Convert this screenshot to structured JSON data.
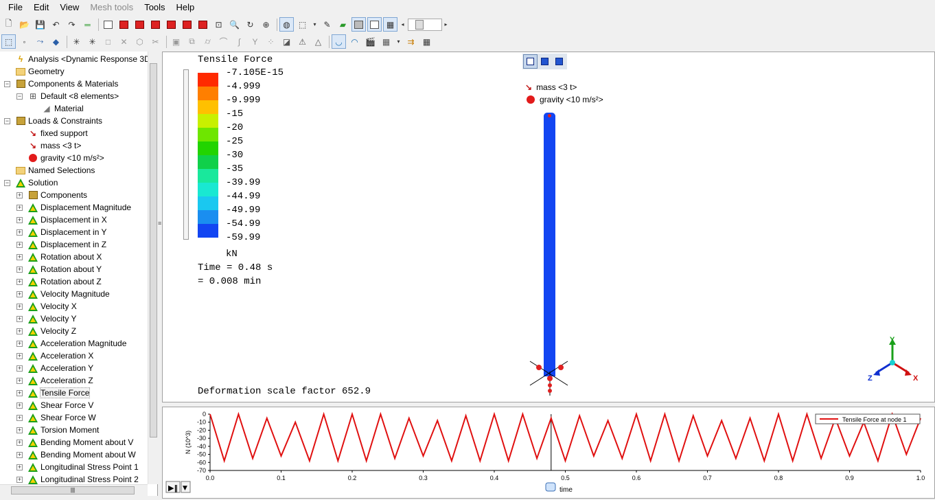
{
  "menu": [
    "File",
    "Edit",
    "View",
    "Mesh tools",
    "Tools",
    "Help"
  ],
  "menu_disabled": [
    false,
    false,
    false,
    true,
    false,
    false
  ],
  "tree": [
    {
      "label": "Analysis <Dynamic Response 3D",
      "icon": "analysis-icon",
      "level": 1,
      "exp": null
    },
    {
      "label": "Geometry",
      "icon": "folder-icon",
      "level": 1,
      "exp": null
    },
    {
      "label": "Components & Materials",
      "icon": "components-icon",
      "level": 1,
      "exp": "-"
    },
    {
      "label": "Default <8 elements>",
      "icon": "element-icon",
      "level": 2,
      "exp": "-"
    },
    {
      "label": "Material",
      "icon": "material-icon",
      "level": 3,
      "exp": null
    },
    {
      "label": "Loads & Constraints",
      "icon": "loads-icon",
      "level": 1,
      "exp": "-"
    },
    {
      "label": "fixed support",
      "icon": "support-arrow-icon",
      "level": 2,
      "exp": null
    },
    {
      "label": "mass <3 t>",
      "icon": "mass-arrow-icon",
      "level": 2,
      "exp": null
    },
    {
      "label": "gravity <10 m/s²>",
      "icon": "gravity-apple-icon",
      "level": 2,
      "exp": null
    },
    {
      "label": "Named Selections",
      "icon": "named-selections-icon",
      "level": 1,
      "exp": null
    },
    {
      "label": "Solution",
      "icon": "solution-triangle-icon",
      "level": 1,
      "exp": "-"
    },
    {
      "label": "Components",
      "icon": "components-icon",
      "level": 2,
      "exp": "+"
    },
    {
      "label": "Displacement Magnitude",
      "icon": "result-triangle-icon",
      "level": 2,
      "exp": "+"
    },
    {
      "label": "Displacement in X",
      "icon": "result-triangle-icon",
      "level": 2,
      "exp": "+"
    },
    {
      "label": "Displacement in Y",
      "icon": "result-triangle-icon",
      "level": 2,
      "exp": "+"
    },
    {
      "label": "Displacement in Z",
      "icon": "result-triangle-icon",
      "level": 2,
      "exp": "+"
    },
    {
      "label": "Rotation about X",
      "icon": "result-triangle-icon",
      "level": 2,
      "exp": "+"
    },
    {
      "label": "Rotation about Y",
      "icon": "result-triangle-icon",
      "level": 2,
      "exp": "+"
    },
    {
      "label": "Rotation about Z",
      "icon": "result-triangle-icon",
      "level": 2,
      "exp": "+"
    },
    {
      "label": "Velocity Magnitude",
      "icon": "result-triangle-icon",
      "level": 2,
      "exp": "+"
    },
    {
      "label": "Velocity X",
      "icon": "result-triangle-icon",
      "level": 2,
      "exp": "+"
    },
    {
      "label": "Velocity Y",
      "icon": "result-triangle-icon",
      "level": 2,
      "exp": "+"
    },
    {
      "label": "Velocity Z",
      "icon": "result-triangle-icon",
      "level": 2,
      "exp": "+"
    },
    {
      "label": "Acceleration Magnitude",
      "icon": "result-triangle-icon",
      "level": 2,
      "exp": "+"
    },
    {
      "label": "Acceleration X",
      "icon": "result-triangle-icon",
      "level": 2,
      "exp": "+"
    },
    {
      "label": "Acceleration Y",
      "icon": "result-triangle-icon",
      "level": 2,
      "exp": "+"
    },
    {
      "label": "Acceleration Z",
      "icon": "result-triangle-icon",
      "level": 2,
      "exp": "+"
    },
    {
      "label": "Tensile Force",
      "icon": "result-triangle-icon",
      "level": 2,
      "exp": "+",
      "selected": true
    },
    {
      "label": "Shear Force V",
      "icon": "result-triangle-icon",
      "level": 2,
      "exp": "+"
    },
    {
      "label": "Shear Force W",
      "icon": "result-triangle-icon",
      "level": 2,
      "exp": "+"
    },
    {
      "label": "Torsion Moment",
      "icon": "result-triangle-icon",
      "level": 2,
      "exp": "+"
    },
    {
      "label": "Bending Moment about V",
      "icon": "result-triangle-icon",
      "level": 2,
      "exp": "+"
    },
    {
      "label": "Bending Moment about W",
      "icon": "result-triangle-icon",
      "level": 2,
      "exp": "+"
    },
    {
      "label": "Longitudinal Stress Point 1",
      "icon": "result-triangle-icon",
      "level": 2,
      "exp": "+"
    },
    {
      "label": "Longitudinal Stress Point 2",
      "icon": "result-triangle-icon",
      "level": 2,
      "exp": "+"
    }
  ],
  "legend": {
    "title": "Tensile Force",
    "labels": [
      "-7.105E-15",
      "-4.999",
      "-9.999",
      "-15",
      "-20",
      "-25",
      "-30",
      "-35",
      "-39.99",
      "-44.99",
      "-49.99",
      "-54.99",
      "-59.99"
    ],
    "colors": [
      "#ff2a00",
      "#ff7f00",
      "#ffc000",
      "#c8f000",
      "#6ee600",
      "#22d400",
      "#10d04a",
      "#19e89c",
      "#19e8d2",
      "#1ac8f0",
      "#1a8ef0",
      "#1245f2"
    ],
    "unit": "kN"
  },
  "view": {
    "time_line1": "Time = 0.48 s",
    "time_line2": "= 0.008 min",
    "deformation": "Deformation scale factor 652.9",
    "load_mass": "mass <3 t>",
    "load_gravity": "gravity <10 m/s²>",
    "axis_y": "Y",
    "axis_z": "Z",
    "axis_x": "X"
  },
  "chart_data": {
    "type": "line",
    "title": "",
    "xlabel": "time",
    "ylabel": "N (10^3)",
    "xlim": [
      0,
      1.0
    ],
    "ylim": [
      -70,
      0
    ],
    "xticks": [
      "0.0",
      "0.1",
      "0.2",
      "0.3",
      "0.4",
      "0.5",
      "0.6",
      "0.7",
      "0.8",
      "0.9",
      "1.0"
    ],
    "yticks": [
      "0",
      "-10",
      "-20",
      "-30",
      "-40",
      "-50",
      "-60",
      "-70"
    ],
    "legend_position": "top-right",
    "series": [
      {
        "name": "Tensile Force at node 1",
        "color": "#e01010",
        "x": [
          0.0,
          0.02,
          0.04,
          0.06,
          0.08,
          0.1,
          0.12,
          0.14,
          0.16,
          0.18,
          0.2,
          0.22,
          0.24,
          0.26,
          0.28,
          0.3,
          0.32,
          0.34,
          0.36,
          0.38,
          0.4,
          0.42,
          0.44,
          0.46,
          0.48,
          0.5,
          0.52,
          0.54,
          0.56,
          0.58,
          0.6,
          0.62,
          0.64,
          0.66,
          0.68,
          0.7,
          0.72,
          0.74,
          0.76,
          0.78,
          0.8,
          0.82,
          0.84,
          0.86,
          0.88,
          0.9,
          0.92,
          0.94,
          0.96,
          0.98,
          1.0
        ],
        "y": [
          0,
          -58,
          0,
          -55,
          -5,
          -52,
          -10,
          -58,
          0,
          -58,
          0,
          -58,
          0,
          -55,
          -5,
          -52,
          -8,
          -58,
          -2,
          -58,
          0,
          -58,
          0,
          -55,
          -5,
          -58,
          -2,
          -52,
          -8,
          -55,
          0,
          -58,
          0,
          -58,
          -2,
          -52,
          -8,
          -55,
          -5,
          -58,
          0,
          -58,
          0,
          -55,
          -5,
          -52,
          -10,
          -58,
          0,
          -50,
          -5
        ]
      }
    ],
    "cursor_x": 0.48
  }
}
